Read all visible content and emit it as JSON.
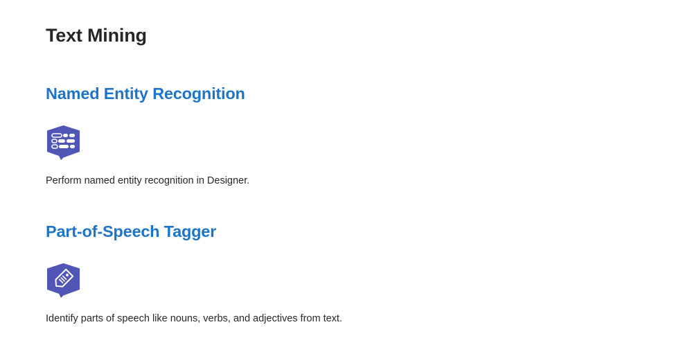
{
  "page": {
    "title": "Text Mining"
  },
  "tools": [
    {
      "title": "Named Entity Recognition",
      "description": "Perform named entity recognition in Designer.",
      "icon": "named-entity-recognition-icon"
    },
    {
      "title": "Part-of-Speech Tagger",
      "description": "Identify parts of speech like nouns, verbs, and adjectives from text.",
      "icon": "part-of-speech-tag-icon"
    }
  ],
  "colors": {
    "heading": "#242628",
    "link": "#1e74c8",
    "icon_bg": "#4f56b5",
    "icon_fg": "#ffffff",
    "body_text": "#262829"
  }
}
